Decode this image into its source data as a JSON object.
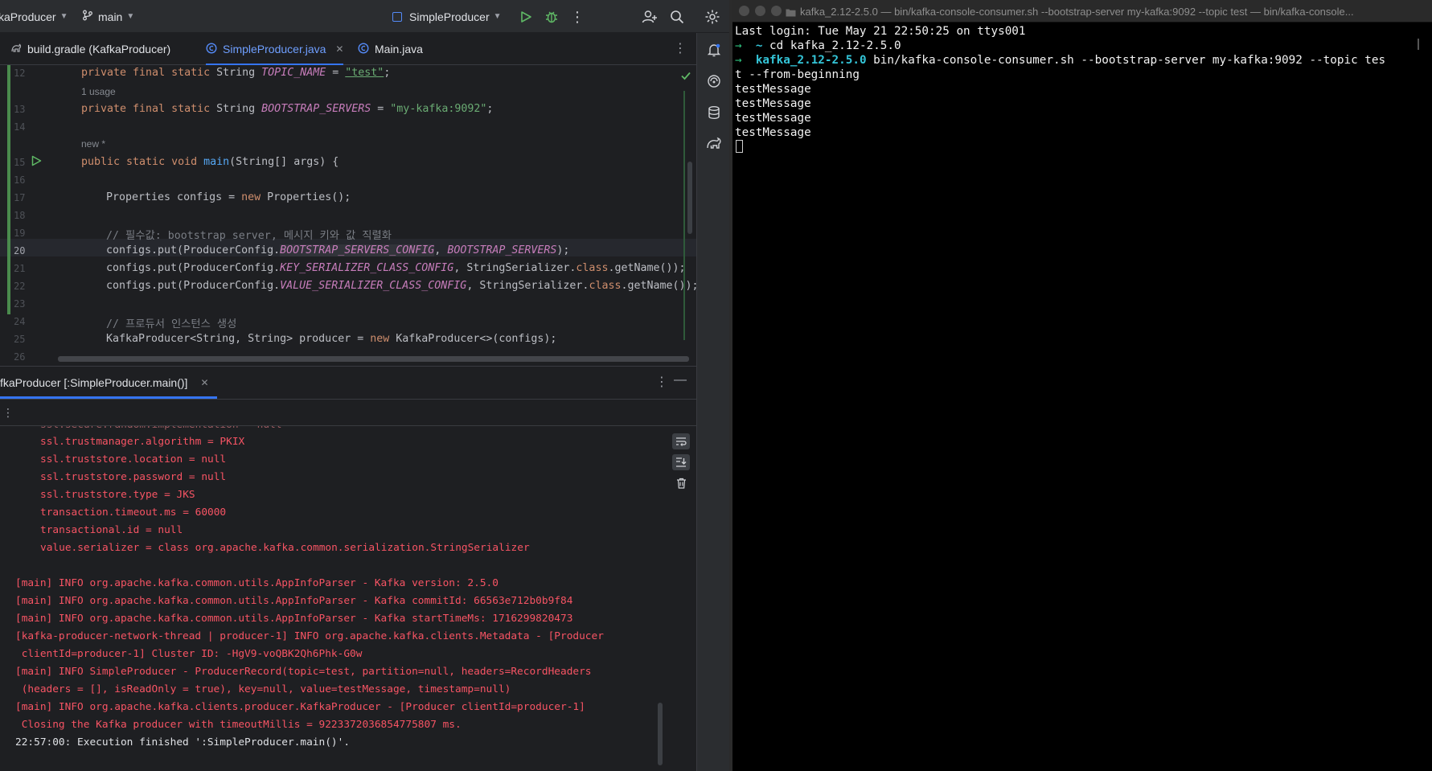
{
  "ide": {
    "toolbar": {
      "project": "kaProducer",
      "branch": "main",
      "run_config": "SimpleProducer"
    },
    "tabs": [
      {
        "label": "build.gradle (KafkaProducer)"
      },
      {
        "label": "SimpleProducer.java"
      },
      {
        "label": "Main.java"
      }
    ],
    "editor": {
      "line_numbers": [
        "12",
        "13",
        "14",
        "15",
        "16",
        "17",
        "18",
        "19",
        "20",
        "21",
        "22",
        "23",
        "24",
        "25",
        "26"
      ],
      "hints": [
        "1 usage",
        "new *"
      ],
      "lines": {
        "l12": {
          "a": "private final static ",
          "b": "String ",
          "c": "TOPIC_NAME",
          "d": " = ",
          "e": "\"test\"",
          "f": ";"
        },
        "l13": {
          "a": "private final static ",
          "b": "String ",
          "c": "BOOTSTRAP_SERVERS",
          "d": " = ",
          "e": "\"my-kafka:9092\"",
          "f": ";"
        },
        "l15": {
          "a": "public static void ",
          "b": "main",
          "c": "(String[] args) {"
        },
        "l17": {
          "a": "Properties configs = ",
          "b": "new ",
          "c": "Properties();"
        },
        "l19": "// 필수값: bootstrap server, 메시지 키와 값 직렬화",
        "l20": {
          "a": "configs.put(ProducerConfig.",
          "b": "BOOTSTRAP_SERVERS_CONFIG",
          "c": ", ",
          "d": "BOOTSTRAP_SERVERS",
          "e": ");"
        },
        "l21": {
          "a": "configs.put(ProducerConfig.",
          "b": "KEY_SERIALIZER_CLASS_CONFIG",
          "c": ", StringSerializer.",
          "d": "class",
          "e": ".getName());"
        },
        "l22": {
          "a": "configs.put(ProducerConfig.",
          "b": "VALUE_SERIALIZER_CLASS_CONFIG",
          "c": ", StringSerializer.",
          "d": "class",
          "e": ".getName());"
        },
        "l24": "// 프로듀서 인스턴스 생성",
        "l25": {
          "a": "KafkaProducer<String, String> producer = ",
          "b": "new ",
          "c": "KafkaProducer<>(configs);"
        }
      }
    },
    "run_panel": {
      "tab_label": "fkaProducer [:SimpleProducer.main()]",
      "config_lines": [
        "ssl.trustmanager.algorithm = PKIX",
        "ssl.truststore.location = null",
        "ssl.truststore.password = null",
        "ssl.truststore.type = JKS",
        "transaction.timeout.ms = 60000",
        "transactional.id = null",
        "value.serializer = class org.apache.kafka.common.serialization.StringSerializer"
      ],
      "log_lines": [
        "[main] INFO org.apache.kafka.common.utils.AppInfoParser - Kafka version: 2.5.0",
        "[main] INFO org.apache.kafka.common.utils.AppInfoParser - Kafka commitId: 66563e712b0b9f84",
        "[main] INFO org.apache.kafka.common.utils.AppInfoParser - Kafka startTimeMs: 1716299820473",
        "[kafka-producer-network-thread | producer-1] INFO org.apache.kafka.clients.Metadata - [Producer",
        " clientId=producer-1] Cluster ID: -HgV9-voQBK2Qh6Phk-G0w",
        "[main] INFO SimpleProducer - ProducerRecord(topic=test, partition=null, headers=RecordHeaders",
        " (headers = [], isReadOnly = true), key=null, value=testMessage, timestamp=null)",
        "[main] INFO org.apache.kafka.clients.producer.KafkaProducer - [Producer clientId=producer-1]",
        " Closing the Kafka producer with timeoutMillis = 9223372036854775807 ms."
      ],
      "finish_line": "22:57:00: Execution finished ':SimpleProducer.main()'."
    }
  },
  "terminal": {
    "title": "kafka_2.12-2.5.0 — bin/kafka-console-consumer.sh --bootstrap-server my-kafka:9092 --topic test — bin/kafka-console...",
    "last_login": "Last login: Tue May 21 22:50:25 on ttys001",
    "prompt_arrow": "→",
    "cmd1_dir": "~",
    "cmd1": "cd kafka_2.12-2.5.0",
    "cmd2_dir": "kafka_2.12-2.5.0",
    "cmd2": "bin/kafka-console-consumer.sh --bootstrap-server my-kafka:9092 --topic tes",
    "cmd2_wrap": "t --from-beginning",
    "messages": [
      "testMessage",
      "testMessage",
      "testMessage",
      "testMessage"
    ]
  },
  "colors": {
    "accent": "#3574f0",
    "error_text": "#f75464",
    "terminal_cyan": "#34c5d8",
    "terminal_green": "#2ec27e"
  }
}
